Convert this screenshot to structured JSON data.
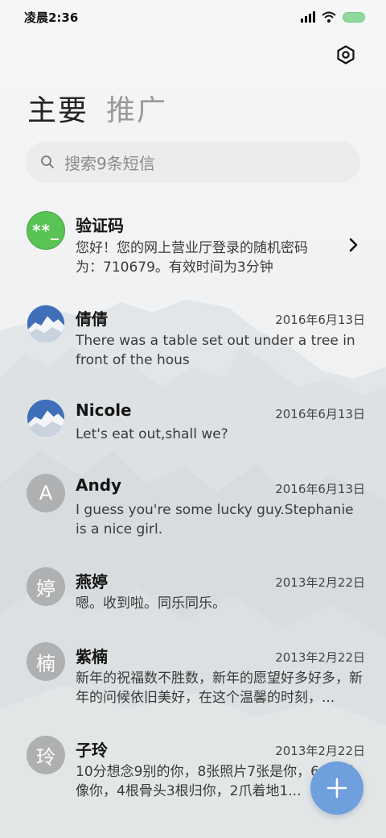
{
  "status_bar": {
    "time": "凌晨2:36",
    "icons": [
      "signal-icon",
      "wifi-icon",
      "battery-icon"
    ]
  },
  "header": {
    "settings_icon": "settings-icon"
  },
  "tabs": [
    {
      "label": "主要",
      "active": true
    },
    {
      "label": "推广",
      "active": false
    }
  ],
  "search": {
    "placeholder": "搜索9条短信",
    "icon": "search-icon"
  },
  "conversations": [
    {
      "name": "验证码",
      "avatar_text": "**_",
      "avatar_type": "green",
      "date": "",
      "message": "您好！您的网上营业厅登录的随机密码为：710679。有效时间为3分钟",
      "message_line1": "您好！您的网上营业厅登录的随机密码",
      "message_line2": "为：710679。有效时间为3分钟"
    },
    {
      "name": "倩倩",
      "avatar_text": "",
      "avatar_type": "photo",
      "date": "2016年6月13日",
      "message": "There was a table set out under a tree in front of the hous"
    },
    {
      "name": "Nicole",
      "avatar_text": "",
      "avatar_type": "photo",
      "date": "2016年6月13日",
      "message": "Let's eat out,shall we?"
    },
    {
      "name": "Andy",
      "avatar_text": "A",
      "avatar_type": "gray",
      "date": "2016年6月13日",
      "message": "I guess you're some lucky guy.Stephanie is a nice girl."
    },
    {
      "name": "燕婷",
      "avatar_text": "婷",
      "avatar_type": "gray",
      "date": "2013年2月22日",
      "message": "嗯。收到啦。同乐同乐。"
    },
    {
      "name": "紫楠",
      "avatar_text": "楠",
      "avatar_type": "gray",
      "date": "2013年2月22日",
      "message": "新年的祝福数不胜数，新年的愿望好多好多，新年的问候依旧美好，在这个温馨的时刻，..."
    },
    {
      "name": "子玲",
      "avatar_text": "玲",
      "avatar_type": "gray",
      "date": "2013年2月22日",
      "message": "10分想念9别的你，8张照片7张是你，6...5只像你，4根骨头3根归你，2爪着地1..."
    }
  ],
  "fab": {
    "icon": "plus-icon"
  },
  "colors": {
    "accent": "#6f9fdc",
    "green_avatar": "#59c354",
    "gray_avatar": "#aeb0b2"
  }
}
